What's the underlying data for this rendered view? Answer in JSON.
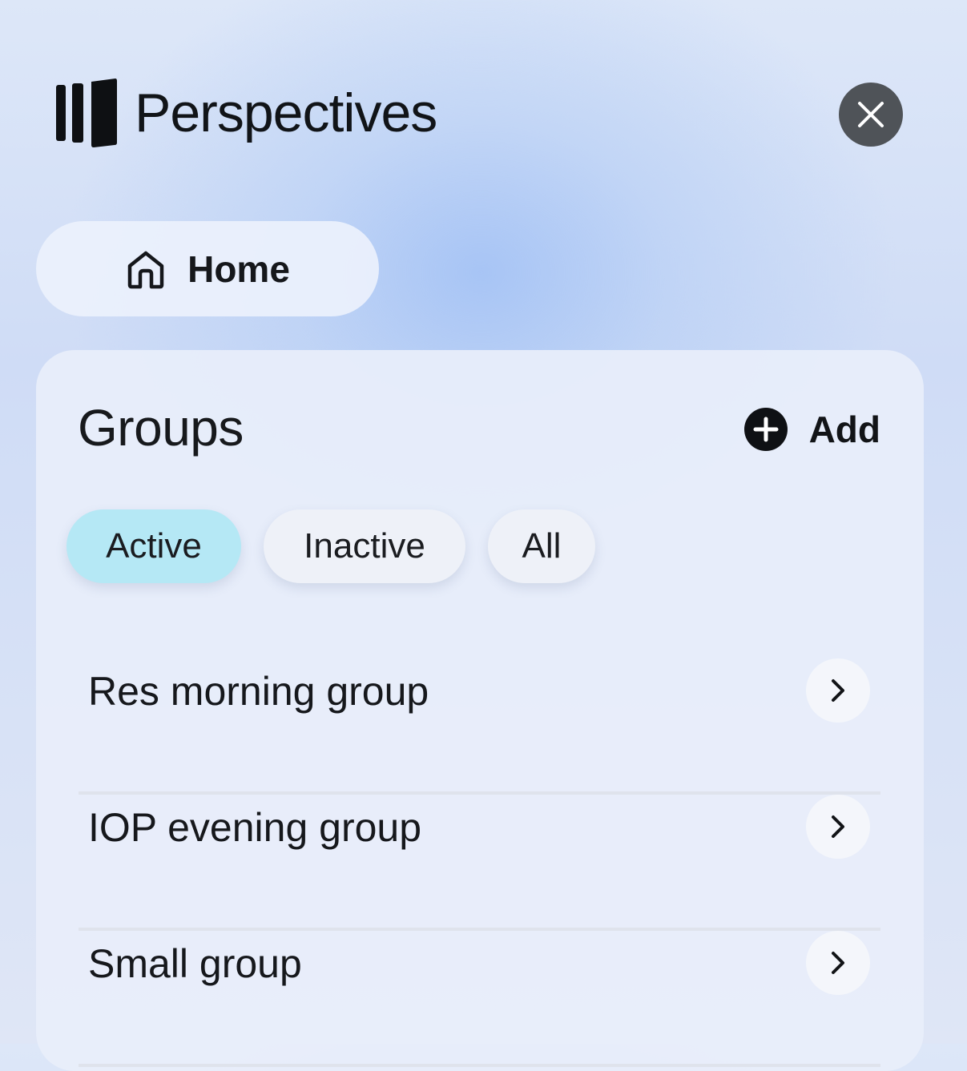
{
  "header": {
    "title": "Perspectives",
    "logo_icon": "perspectives-logo-icon",
    "close_icon": "close-icon"
  },
  "nav": {
    "home_label": "Home",
    "home_icon": "home-icon"
  },
  "groups": {
    "title": "Groups",
    "add_label": "Add",
    "add_icon": "plus-circle-icon",
    "filters": [
      {
        "label": "Active",
        "selected": true
      },
      {
        "label": "Inactive",
        "selected": false
      },
      {
        "label": "All",
        "selected": false
      }
    ],
    "items": [
      {
        "name": "Res morning group"
      },
      {
        "name": "IOP evening group"
      },
      {
        "name": "Small group"
      }
    ],
    "row_icon": "chevron-right-icon"
  },
  "colors": {
    "active_chip": "#b5e8f5",
    "close_button": "#4f5358",
    "text": "#16181c"
  }
}
